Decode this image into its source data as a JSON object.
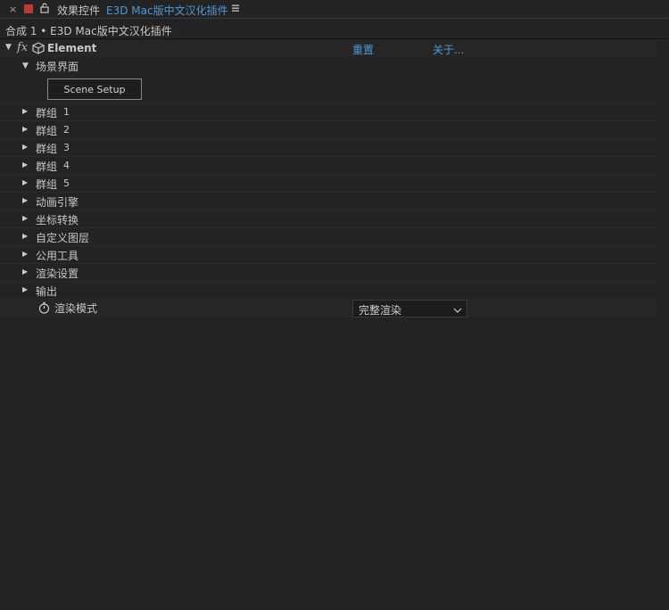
{
  "tab": {
    "close_glyph": "×",
    "label_color": "#c0383a",
    "title": "效果控件",
    "layer_name": "E3D Mac版中文汉化插件",
    "accent": "#4c9bd9"
  },
  "breadcrumb": "合成 1 • E3D Mac版中文汉化插件",
  "effect": {
    "name": "Element",
    "reset_label": "重置",
    "about_label": "关于..."
  },
  "scene": {
    "label": "场景界面",
    "button_label": "Scene Setup"
  },
  "groups": [
    {
      "label": "群组",
      "num": "1"
    },
    {
      "label": "群组",
      "num": "2"
    },
    {
      "label": "群组",
      "num": "3"
    },
    {
      "label": "群组",
      "num": "4"
    },
    {
      "label": "群组",
      "num": "5"
    }
  ],
  "sections": [
    {
      "label": "动画引擎"
    },
    {
      "label": "坐标转换"
    },
    {
      "label": "自定义图层"
    },
    {
      "label": "公用工具"
    },
    {
      "label": "渲染设置"
    },
    {
      "label": "输出"
    }
  ],
  "render_mode": {
    "label": "渲染模式",
    "value": "完整渲染"
  }
}
